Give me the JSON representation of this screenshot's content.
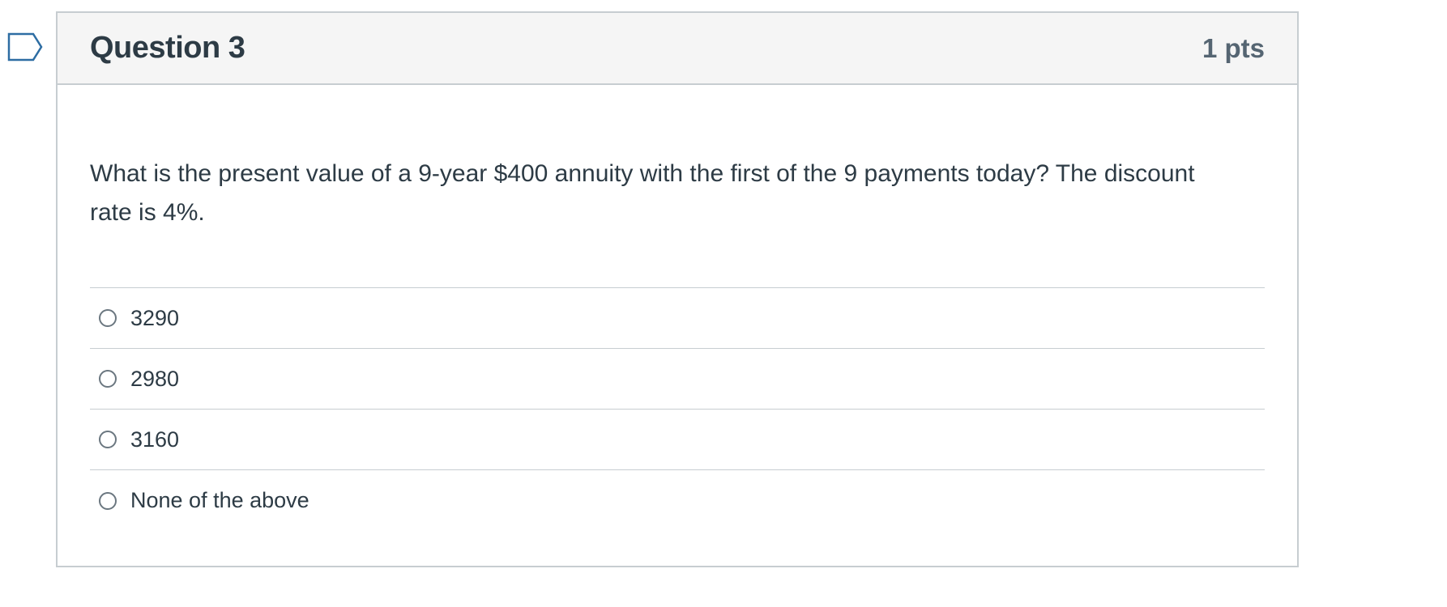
{
  "question": {
    "title": "Question 3",
    "points": "1 pts",
    "text": "What is the present value of a 9-year $400 annuity with the first of the 9 payments today? The discount rate is 4%.",
    "answers": [
      {
        "label": "3290"
      },
      {
        "label": "2980"
      },
      {
        "label": "3160"
      },
      {
        "label": "None of the above"
      }
    ]
  },
  "colors": {
    "header_bg": "#f5f5f5",
    "border": "#c7cdd1",
    "text": "#2d3b45",
    "flag_outline": "#2d6da3"
  },
  "icons": {
    "flag": "bookmark-flag-icon",
    "radio": "radio-unchecked-icon"
  }
}
